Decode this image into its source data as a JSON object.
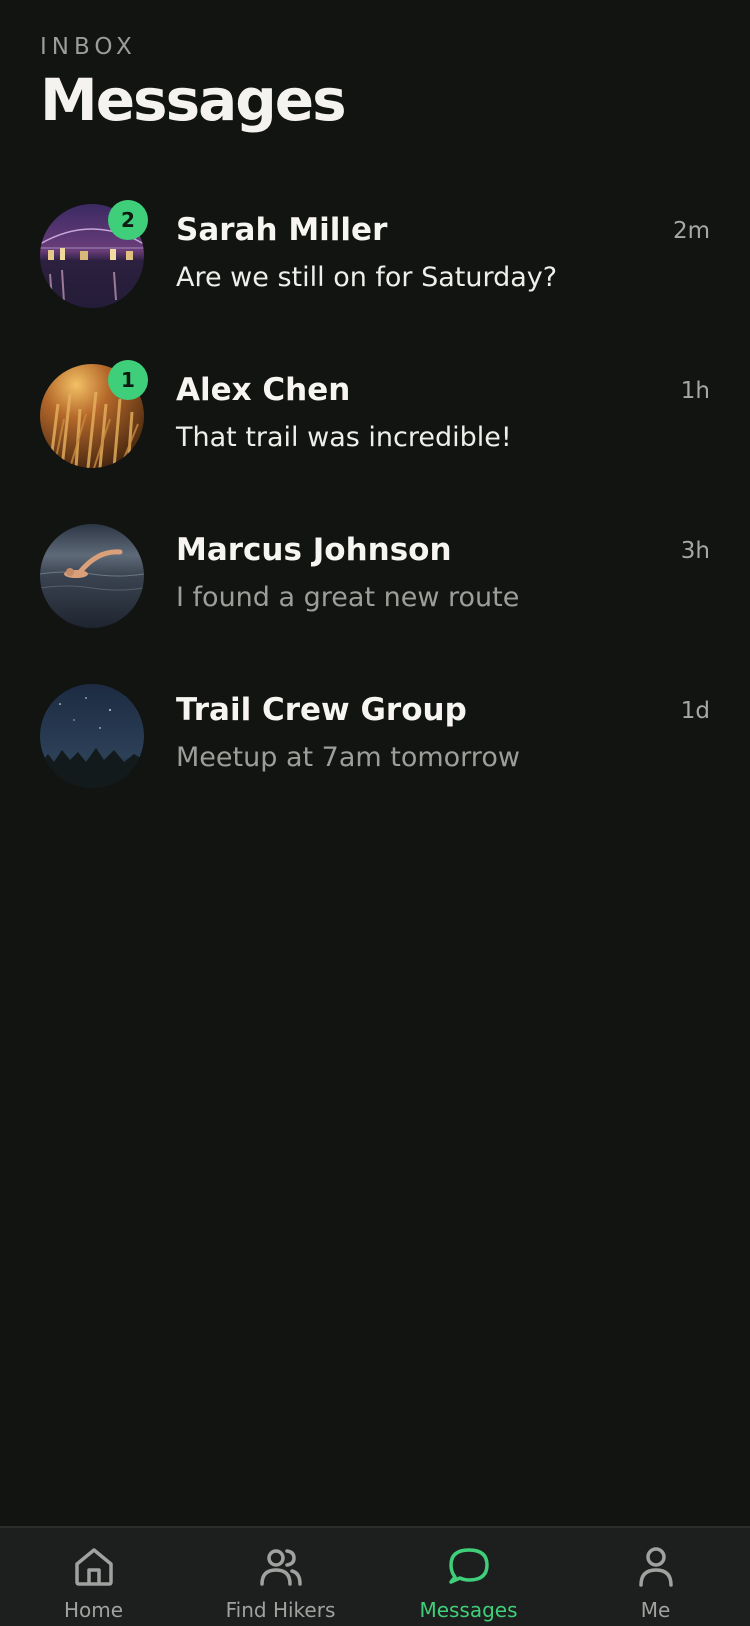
{
  "header": {
    "eyebrow": "INBOX",
    "title": "Messages"
  },
  "conversations": [
    {
      "name": "Sarah Miller",
      "preview": "Are we still on for Saturday?",
      "time": "2m",
      "unread_count": "2",
      "avatar": "city-bridge-night-photo"
    },
    {
      "name": "Alex Chen",
      "preview": "That trail was incredible!",
      "time": "1h",
      "unread_count": "1",
      "avatar": "golden-grass-sunset-photo"
    },
    {
      "name": "Marcus Johnson",
      "preview": "I found a great new route",
      "time": "3h",
      "unread_count": null,
      "avatar": "swimmer-photo"
    },
    {
      "name": "Trail Crew Group",
      "preview": "Meetup at 7am tomorrow",
      "time": "1d",
      "unread_count": null,
      "avatar": "starry-forest-photo"
    }
  ],
  "tabbar": {
    "tabs": [
      {
        "label": "Home",
        "icon": "home-icon"
      },
      {
        "label": "Find Hikers",
        "icon": "users-icon"
      },
      {
        "label": "Messages",
        "icon": "chat-bubble-icon",
        "active": true
      },
      {
        "label": "Me",
        "icon": "person-icon"
      }
    ]
  },
  "colors": {
    "background": "#121412",
    "accent": "#3fcf7a",
    "tabbar": "#1c1f1d"
  }
}
